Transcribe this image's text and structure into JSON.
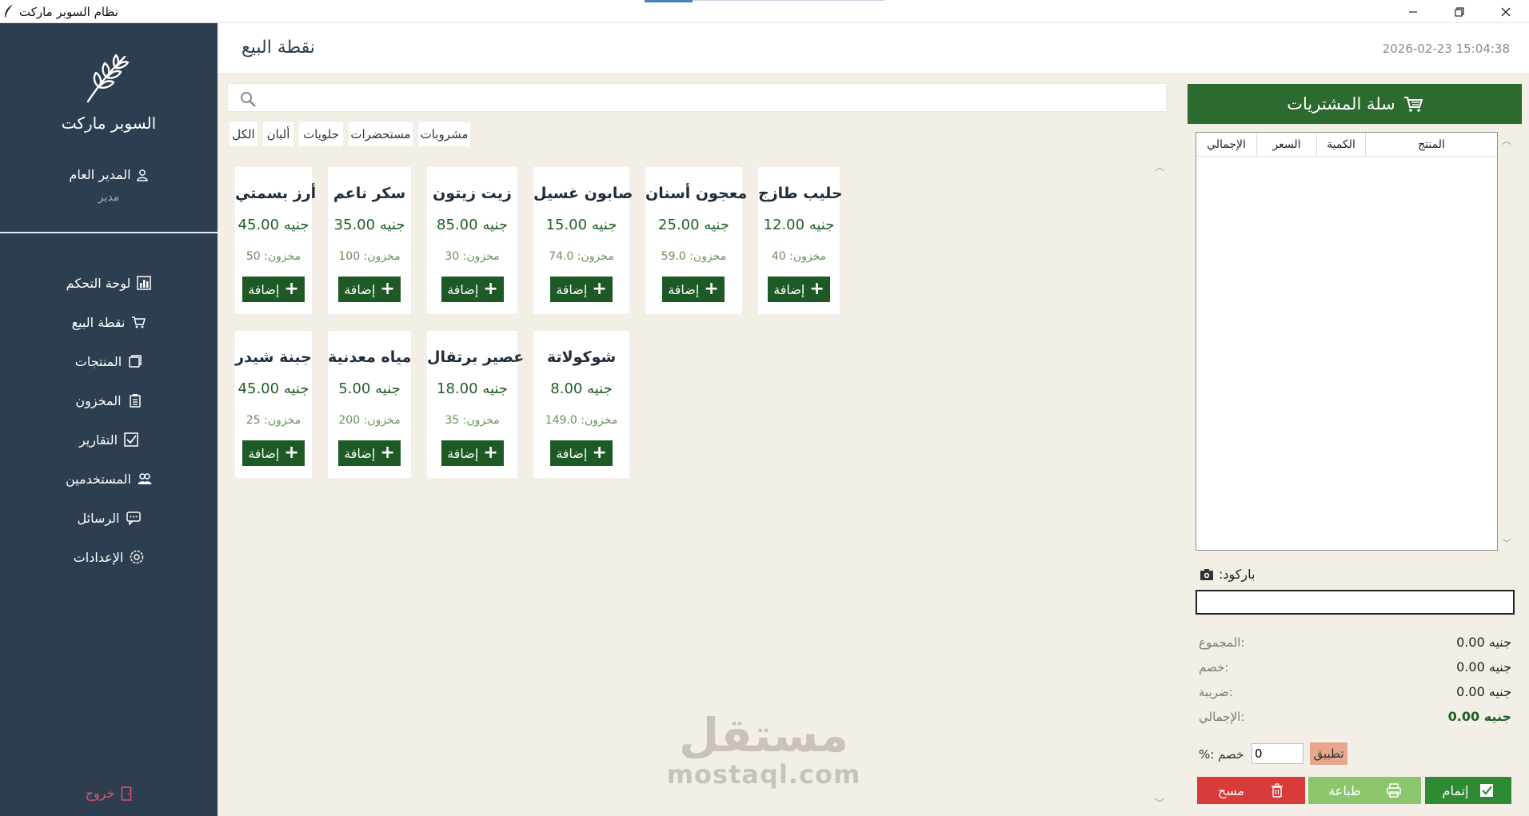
{
  "window": {
    "title": "نظام السوبر ماركت"
  },
  "sidebar": {
    "brand": "السوبر ماركت",
    "user_name": "المدير العام",
    "user_role": "مدير",
    "items": [
      {
        "label": "لوحة التحكم",
        "icon": "chart-icon"
      },
      {
        "label": "نقطة البيع",
        "icon": "cart-icon"
      },
      {
        "label": "المنتجات",
        "icon": "products-icon"
      },
      {
        "label": "المخزون",
        "icon": "clipboard-icon"
      },
      {
        "label": "التقارير",
        "icon": "checkbox-report-icon"
      },
      {
        "label": "المستخدمين",
        "icon": "users-icon"
      },
      {
        "label": "الرسائل",
        "icon": "message-icon"
      },
      {
        "label": "الإعدادات",
        "icon": "gear-icon"
      }
    ],
    "logout": "خروج"
  },
  "header": {
    "title": "نقطة البيع",
    "datetime": "2026-02-23 15:04:38"
  },
  "search": {
    "placeholder": ""
  },
  "categories": [
    "مشروبات",
    "مستحضرات",
    "حلويات",
    "ألبان",
    "الكل"
  ],
  "currency": "جنيه",
  "stock_label": "مخزون:",
  "add_label": "إضافة",
  "products": [
    {
      "name": "حليب طازج",
      "price": "12.00",
      "stock": "40"
    },
    {
      "name": "معجون أسنان",
      "price": "25.00",
      "stock": "59.0"
    },
    {
      "name": "صابون غسيل",
      "price": "15.00",
      "stock": "74.0"
    },
    {
      "name": "زيت زيتون",
      "price": "85.00",
      "stock": "30"
    },
    {
      "name": "سكر ناعم",
      "price": "35.00",
      "stock": "100"
    },
    {
      "name": "أرز بسمتي",
      "price": "45.00",
      "stock": "50"
    },
    {
      "name": "شوكولاتة",
      "price": "8.00",
      "stock": "149.0"
    },
    {
      "name": "عصير برتقال",
      "price": "18.00",
      "stock": "35"
    },
    {
      "name": "مياه معدنية",
      "price": "5.00",
      "stock": "200"
    },
    {
      "name": "جبنة شيدر",
      "price": "45.00",
      "stock": "25"
    }
  ],
  "cart": {
    "title": "سلة المشتريات",
    "columns": [
      "المنتج",
      "الكمية",
      "السعر",
      "الإجمالي"
    ],
    "rows": [],
    "barcode_label": ":باركود",
    "barcode_value": "",
    "summary": [
      {
        "label": "المجموع:",
        "value": "0.00 جنيه"
      },
      {
        "label": "خصم:",
        "value": "0.00 جنيه"
      },
      {
        "label": "ضريبة:",
        "value": "0.00 جنيه"
      },
      {
        "label": "الإجمالي:",
        "value": "0.00 جنيه"
      }
    ],
    "discount_label": "%: خصم",
    "discount_value": "0",
    "apply_label": "تطبيق",
    "clear_label": "مسح",
    "print_label": "طباعة",
    "complete_label": "إتمام"
  },
  "watermark": {
    "arabic": "مستقل",
    "latin": "mostaql.com"
  },
  "colors": {
    "sidebar_bg": "#2c3e50",
    "content_bg": "#f3efe7",
    "primary_green": "#1e5a25",
    "cart_header": "#2d6a2f",
    "clear_red": "#d93a3a",
    "print_green": "#8cc56b",
    "complete_green": "#2e8b34",
    "apply_orange": "#e8a78c",
    "logout_red": "#e05565"
  }
}
